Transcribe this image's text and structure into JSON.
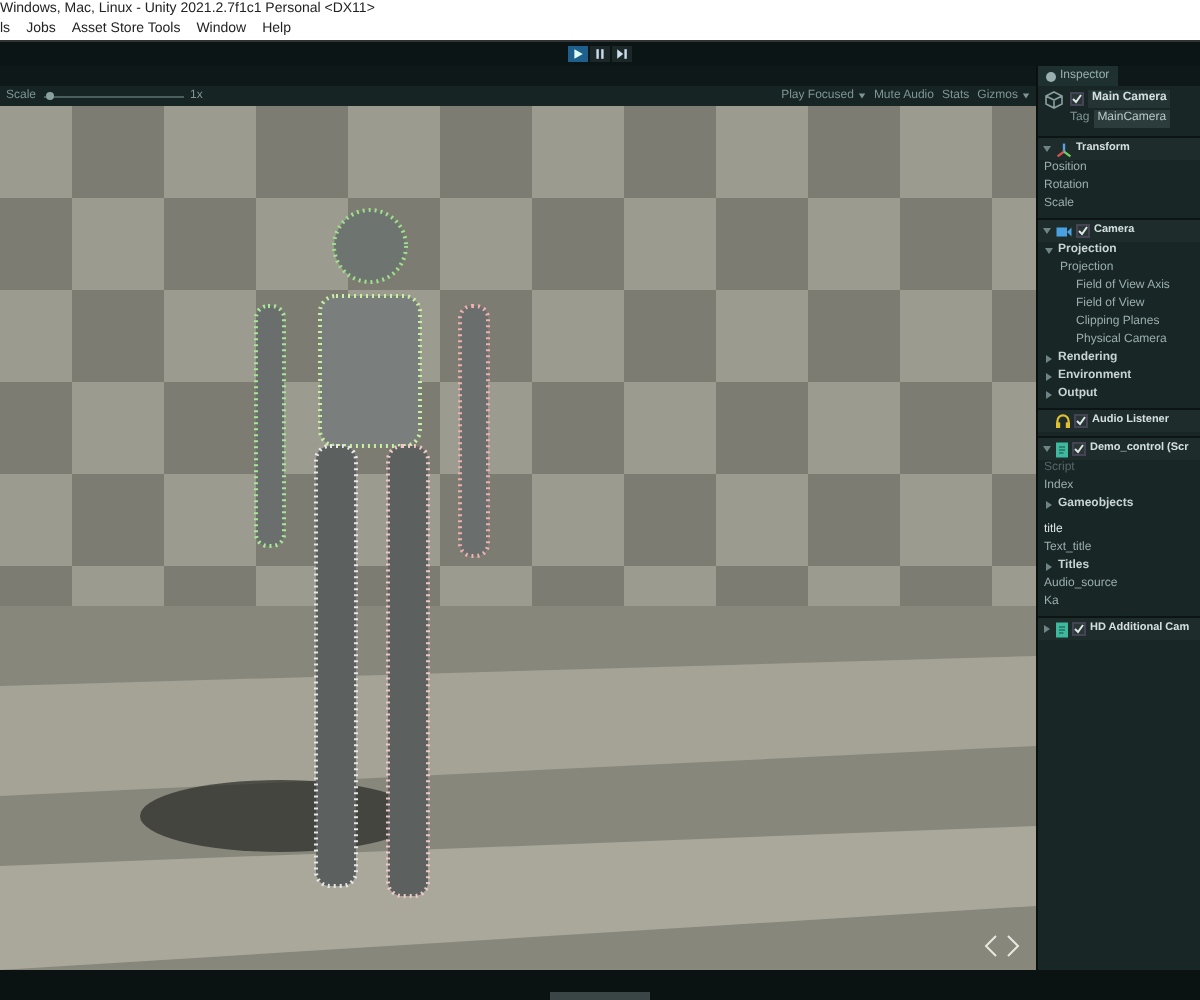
{
  "window": {
    "title": "Windows, Mac, Linux - Unity 2021.2.7f1c1 Personal <DX11>"
  },
  "menu": [
    "ls",
    "Jobs",
    "Asset Store Tools",
    "Window",
    "Help"
  ],
  "play_controls": [
    {
      "kind": "play",
      "selected": true
    },
    {
      "kind": "pause",
      "selected": false
    },
    {
      "kind": "step",
      "selected": false
    }
  ],
  "game_toolbar": {
    "scale_label": "Scale",
    "scale": {
      "level": 0.02
    },
    "scale_value": "1x",
    "items": [
      {
        "label": "Play Focused",
        "dropdown": true
      },
      {
        "label": "Mute Audio",
        "dropdown": false
      },
      {
        "label": "Stats",
        "dropdown": false
      },
      {
        "label": "Gizmos",
        "dropdown": true
      }
    ]
  },
  "inspector": {
    "tab": "Inspector",
    "object": {
      "name": "Main Camera",
      "active": true,
      "tag_label": "Tag",
      "tag": "MainCamera"
    },
    "components": [
      {
        "kind": "transform",
        "title": "Transform",
        "expanded": true,
        "items": [
          {
            "kind": "property",
            "label": "Position"
          },
          {
            "kind": "property",
            "label": "Rotation"
          },
          {
            "kind": "property",
            "label": "Scale"
          }
        ]
      },
      {
        "kind": "camera",
        "title": "Camera",
        "enabled": true,
        "expanded": true,
        "items": [
          {
            "kind": "foldout",
            "label": "Projection",
            "expanded": true,
            "children": [
              {
                "kind": "property",
                "label": "Projection",
                "children": [
                  {
                    "kind": "property",
                    "label": "Field of View Axis"
                  },
                  {
                    "kind": "property",
                    "label": "Field of View"
                  },
                  {
                    "kind": "property",
                    "label": "Clipping Planes"
                  },
                  {
                    "kind": "property",
                    "label": "Physical Camera"
                  }
                ]
              }
            ]
          },
          {
            "kind": "foldout",
            "label": "Rendering",
            "expanded": false
          },
          {
            "kind": "foldout",
            "label": "Environment",
            "expanded": false
          },
          {
            "kind": "foldout",
            "label": "Output",
            "expanded": false
          }
        ]
      },
      {
        "kind": "audio",
        "title": "Audio Listener",
        "enabled": true
      },
      {
        "kind": "script",
        "title": "Demo_control (Scr",
        "enabled": true,
        "expanded": true,
        "items": [
          {
            "kind": "property",
            "label": "Script",
            "disabled": true
          },
          {
            "kind": "property",
            "label": "Index",
            "disabled": false
          },
          {
            "kind": "foldout",
            "label": "Gameobjects",
            "expanded": false
          },
          {
            "kind": "heading",
            "label": "title"
          },
          {
            "kind": "property",
            "label": "Text_title",
            "disabled": false
          },
          {
            "kind": "foldout",
            "label": "Titles",
            "expanded": false
          },
          {
            "kind": "property",
            "label": "Audio_source",
            "disabled": false
          },
          {
            "kind": "property",
            "label": "Ka",
            "disabled": false
          }
        ]
      },
      {
        "kind": "script",
        "title": "HD Additional Cam",
        "enabled": true,
        "expanded": false
      }
    ]
  }
}
